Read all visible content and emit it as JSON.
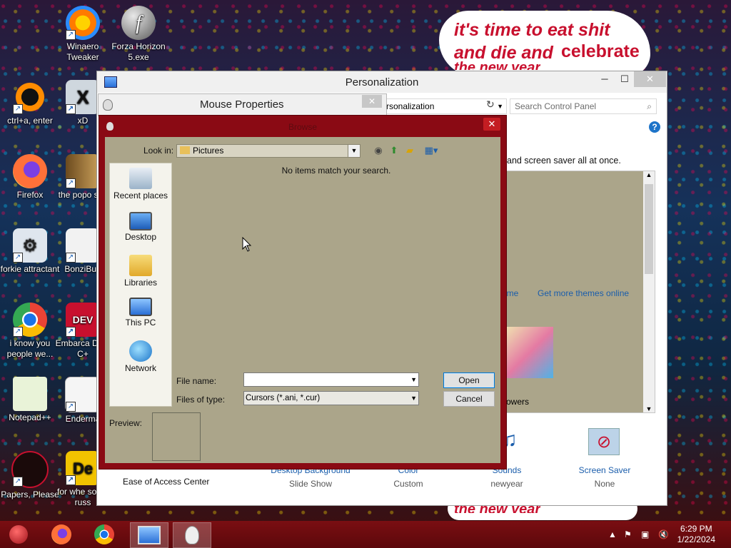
{
  "desktop": {
    "meme": {
      "line1": "it's time to eat shit",
      "line2a": "and die and",
      "line2b": "celebrate",
      "line3": "the new year",
      "bottom": "the new year"
    },
    "icons": [
      {
        "label": "Winaero Tweaker"
      },
      {
        "label": "Forza Horizon 5.exe"
      },
      {
        "label": "ctrl+a, enter"
      },
      {
        "label": "xD"
      },
      {
        "label": "Firefox"
      },
      {
        "label": "the popo shit"
      },
      {
        "label": "forkie attractant"
      },
      {
        "label": "BonziBud"
      },
      {
        "label": "i know you people we..."
      },
      {
        "label": "Embarca Dev-C+"
      },
      {
        "label": "Notepad++"
      },
      {
        "label": "Enderma"
      },
      {
        "label": "Papers, Please"
      },
      {
        "label": "for whe some russ"
      }
    ]
  },
  "personalization": {
    "title": "Personalization",
    "address": "rsonalization",
    "search_placeholder": "Search Control Panel",
    "description": "and screen saver all at once.",
    "theme_link": "eme",
    "more_themes_link": "Get more themes online",
    "flowers_label": "owers",
    "ease_of_access": "Ease of Access Center",
    "bottom": [
      {
        "link": "Desktop Background",
        "value": "Slide Show"
      },
      {
        "link": "Color",
        "value": "Custom"
      },
      {
        "link": "Sounds",
        "value": "newyear"
      },
      {
        "link": "Screen Saver",
        "value": "None"
      }
    ]
  },
  "mouse_properties": {
    "title": "Mouse Properties"
  },
  "browse": {
    "title": "Browse",
    "look_in_label": "Look in:",
    "look_in_value": "Pictures",
    "empty_message": "No items match your search.",
    "places": [
      "Recent places",
      "Desktop",
      "Libraries",
      "This PC",
      "Network"
    ],
    "file_name_label": "File name:",
    "file_name_value": "",
    "files_of_type_label": "Files of type:",
    "files_of_type_value": "Cursors (*.ani, *.cur)",
    "open_label": "Open",
    "cancel_label": "Cancel",
    "preview_label": "Preview:"
  },
  "taskbar": {
    "time": "6:29 PM",
    "date": "1/22/2024"
  }
}
